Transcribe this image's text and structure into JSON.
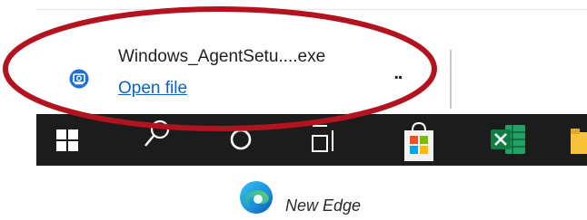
{
  "download": {
    "file_name": "Windows_AgentSetu....exe",
    "open_link": "Open file",
    "more_label": "..",
    "file_icon": "installer-file-icon"
  },
  "taskbar": {
    "items": [
      {
        "icon": "windows-start-icon"
      },
      {
        "icon": "search-icon"
      },
      {
        "icon": "cortana-icon"
      },
      {
        "icon": "task-view-icon"
      },
      {
        "icon": "microsoft-store-icon"
      },
      {
        "icon": "excel-icon"
      },
      {
        "icon": "file-explorer-icon"
      }
    ]
  },
  "caption": {
    "text": "New Edge",
    "logo": "edge-logo-icon"
  },
  "colors": {
    "highlight": "#b3121f",
    "link": "#0a64c8",
    "taskbar_bg": "#1c1c1c"
  }
}
